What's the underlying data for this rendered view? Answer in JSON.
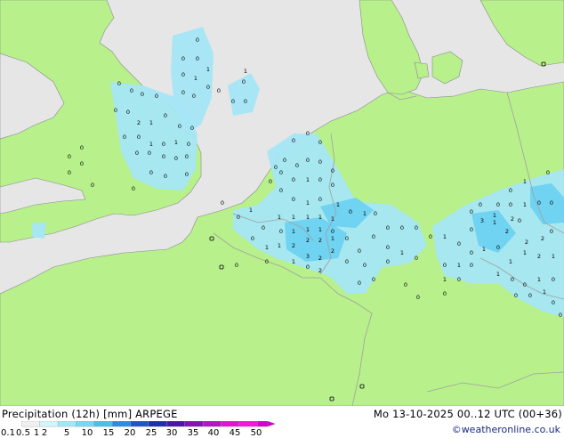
{
  "map": {
    "colors": {
      "sea": "#e6e6e6",
      "land": "#b8f08c",
      "border": "#a0a0a0",
      "coast": "#8a8a8a",
      "precip_light": "#a5e6f5",
      "precip_mid": "#6cd2f0"
    },
    "precip_labels": [
      "0",
      "1",
      "2",
      "3"
    ]
  },
  "footer": {
    "title": "Precipitation (12h) [mm] ARPEGE",
    "timestamp": "Mo 13-10-2025 00..12 UTC (00+36)",
    "credit": "©weatheronline.co.uk"
  },
  "legend": {
    "ticks": [
      "0.1",
      "0.5",
      "1",
      "2",
      "5",
      "10",
      "15",
      "20",
      "25",
      "30",
      "35",
      "40",
      "45",
      "50"
    ],
    "colors": [
      "#f0f0f0",
      "#d2f5fa",
      "#a5e6f5",
      "#78d7f0",
      "#4bbeeb",
      "#2d8ce1",
      "#2355c8",
      "#1e2db4",
      "#4b14aa",
      "#8214b4",
      "#b414c3",
      "#e114d2",
      "#f514e1",
      "#d200c8"
    ]
  }
}
